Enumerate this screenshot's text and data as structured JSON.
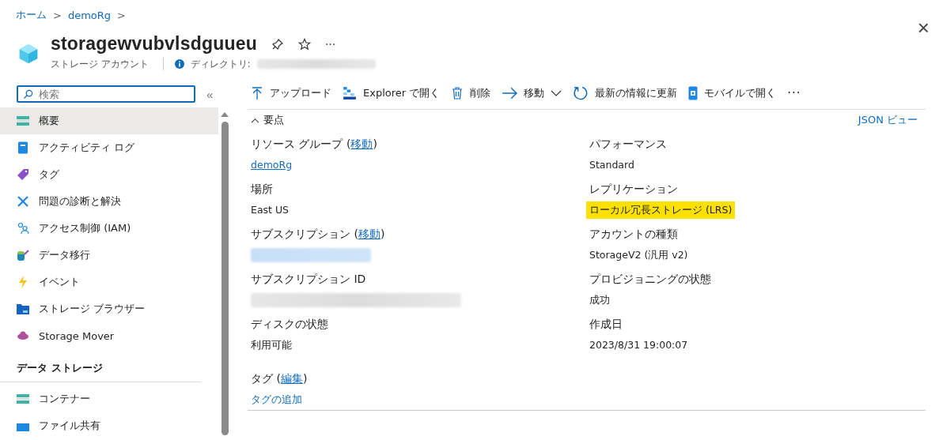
{
  "breadcrumb": [
    {
      "label": "ホーム",
      "separator": ">"
    },
    {
      "label": "demoRg",
      "separator": ">"
    }
  ],
  "header": {
    "title": "storagewvubvlsdguueu",
    "subtitle": "ストレージ アカウント",
    "directory_label": "ディレクトリ:",
    "more": "···"
  },
  "close": "×",
  "sidebar": {
    "search": {
      "placeholder": "検索"
    },
    "collapse": "«",
    "items": [
      {
        "kind": "item",
        "label": "概要",
        "selected": true
      },
      {
        "kind": "item",
        "label": "アクティビティ ログ",
        "selected": false
      },
      {
        "kind": "item",
        "label": "タグ",
        "selected": false
      },
      {
        "kind": "item",
        "label": "問題の診断と解決",
        "selected": false
      },
      {
        "kind": "item",
        "label": "アクセス制御 (IAM)",
        "selected": false
      },
      {
        "kind": "item",
        "label": "データ移行",
        "selected": false
      },
      {
        "kind": "item",
        "label": "イベント",
        "selected": false
      },
      {
        "kind": "item",
        "label": "ストレージ ブラウザー",
        "selected": false
      },
      {
        "kind": "item",
        "label": "Storage Mover",
        "selected": false
      },
      {
        "kind": "section",
        "label": "データ ストレージ"
      },
      {
        "kind": "item",
        "label": "コンテナー",
        "selected": false
      },
      {
        "kind": "item",
        "label": "ファイル共有",
        "selected": false
      }
    ]
  },
  "toolbar": [
    {
      "label": "アップロード",
      "dropdown": false
    },
    {
      "label": "Explorer で開く",
      "dropdown": false
    },
    {
      "label": "削除",
      "dropdown": false
    },
    {
      "label": "移動",
      "dropdown": true
    },
    {
      "label": "最新の情報に更新",
      "dropdown": false
    },
    {
      "label": "モバイルで開く",
      "dropdown": false
    },
    {
      "label": "···",
      "dropdown": false
    }
  ],
  "essentials": {
    "title": "要点",
    "json_view": "JSON ビュー",
    "left": [
      {
        "label": "リソース グループ (",
        "action": "移動",
        "close": ")",
        "value": "demoRg",
        "kind": "link"
      },
      {
        "label": "場所",
        "value": "East US",
        "kind": "text"
      },
      {
        "label": "サブスクリプション (",
        "action": "移動",
        "close": ")",
        "kind": "redacted-link"
      },
      {
        "label": "サブスクリプション ID",
        "kind": "redacted"
      },
      {
        "label": "ディスクの状態",
        "value": "利用可能",
        "kind": "text"
      }
    ],
    "right": [
      {
        "label": "パフォーマンス",
        "value": "Standard",
        "kind": "text",
        "highlighted": false
      },
      {
        "label": "レプリケーション",
        "value": "ローカル冗長ストレージ (LRS)",
        "kind": "text",
        "highlighted": true
      },
      {
        "label": "アカウントの種類",
        "value": "StorageV2 (汎用 v2)",
        "kind": "text",
        "highlighted": false
      },
      {
        "label": "プロビジョニングの状態",
        "value": "成功",
        "kind": "text",
        "highlighted": false
      },
      {
        "label": "作成日",
        "value": "2023/8/31 19:00:07",
        "kind": "text",
        "highlighted": false
      }
    ],
    "tags": {
      "label": "タグ (",
      "action": "編集",
      "close": ")",
      "value": "タグの追加"
    }
  }
}
